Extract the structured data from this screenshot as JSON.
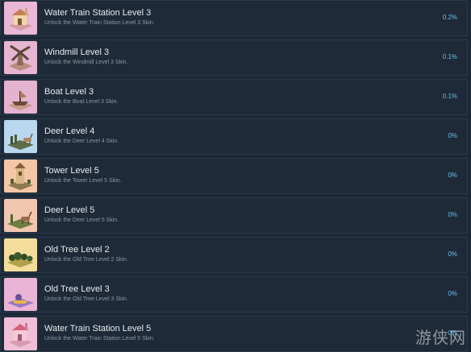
{
  "achievements": [
    {
      "title": "Water Train Station Level 3",
      "description": "Unlock the Water Train Station Level 3 Skin.",
      "percent": "0.2%",
      "icon": "water-train-station-icon",
      "bg": "#e9b8d6"
    },
    {
      "title": "Windmill Level 3",
      "description": "Unlock the Windmill Level 3 Skin.",
      "percent": "0.1%",
      "icon": "windmill-icon",
      "bg": "#e6b5d2"
    },
    {
      "title": "Boat Level 3",
      "description": "Unlock the Boat Level 3 Skin.",
      "percent": "0.1%",
      "icon": "boat-icon",
      "bg": "#e4b3cf"
    },
    {
      "title": "Deer Level 4",
      "description": "Unlock the Deer Level 4 Skin.",
      "percent": "0%",
      "icon": "deer-icon",
      "bg": "#b9d7ef"
    },
    {
      "title": "Tower Level 5",
      "description": "Unlock the Tower Level 5 Skin.",
      "percent": "0%",
      "icon": "tower-icon",
      "bg": "#f3c7a6"
    },
    {
      "title": "Deer Level 5",
      "description": "Unlock the Deer Level 5 Skin.",
      "percent": "0%",
      "icon": "deer-icon",
      "bg": "#f2c7b1"
    },
    {
      "title": "Old Tree Level 2",
      "description": "Unlock the Old Tree Level 2 Skin.",
      "percent": "0%",
      "icon": "old-tree-icon",
      "bg": "#f4dd9b"
    },
    {
      "title": "Old Tree Level 3",
      "description": "Unlock the Old Tree Level 3 Skin.",
      "percent": "0%",
      "icon": "old-tree-icon",
      "bg": "#e9b4d6"
    },
    {
      "title": "Water Train Station Level 5",
      "description": "Unlock the Water Train Station Level 5 Skin.",
      "percent": "0%",
      "icon": "water-train-station-icon",
      "bg": "#f0bfd7"
    }
  ],
  "watermark": "游侠网",
  "colors": {
    "background": "#1b2838",
    "row": "#1e2a38",
    "title": "#e6ebf0",
    "description": "#8f98a0",
    "percent": "#66c0f4"
  }
}
